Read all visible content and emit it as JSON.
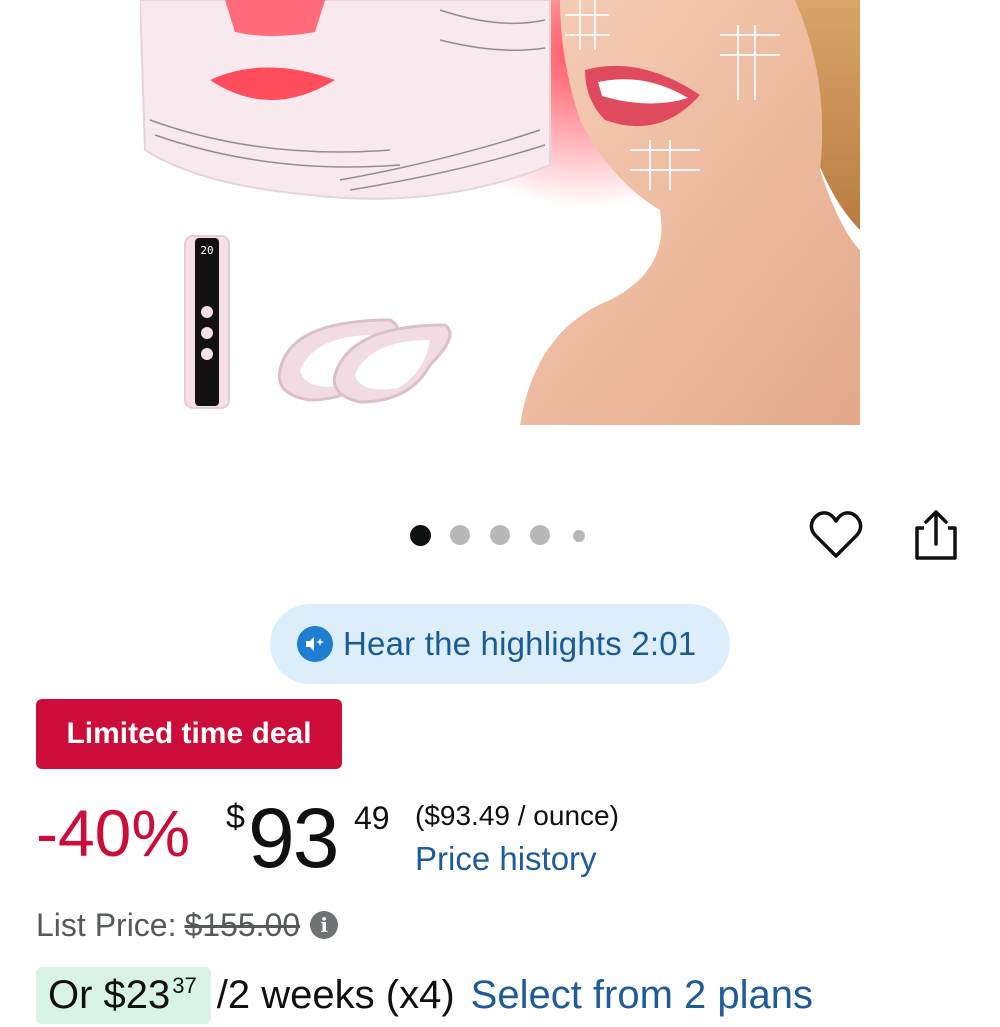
{
  "product_image": {
    "alt": "",
    "remote_display": "20"
  },
  "carousel": {
    "total": 5,
    "active_index": 0
  },
  "actions": {
    "wishlist_icon": "heart-outline-icon",
    "share_icon": "share-icon"
  },
  "audio": {
    "icon": "audio-sparkle-icon",
    "label": "Hear the highlights 2:01"
  },
  "deal": {
    "badge": "Limited time deal"
  },
  "price": {
    "discount": "-40%",
    "currency": "$",
    "whole": "93",
    "fraction": "49",
    "unit_price": "($93.49 / ounce)",
    "history_link": "Price history"
  },
  "list_price": {
    "label": "List Price:",
    "value": "$155.00",
    "info_icon": "i"
  },
  "installment": {
    "prefix": "Or $",
    "whole": "23",
    "fraction": "37",
    "terms": "/2 weeks (x4)",
    "link": "Select from 2 plans"
  },
  "colors": {
    "deal_red": "#cc0c39",
    "link_blue": "#1f5b99",
    "pill_bg": "#dbeef9",
    "installment_bg": "#d8f3e6"
  }
}
